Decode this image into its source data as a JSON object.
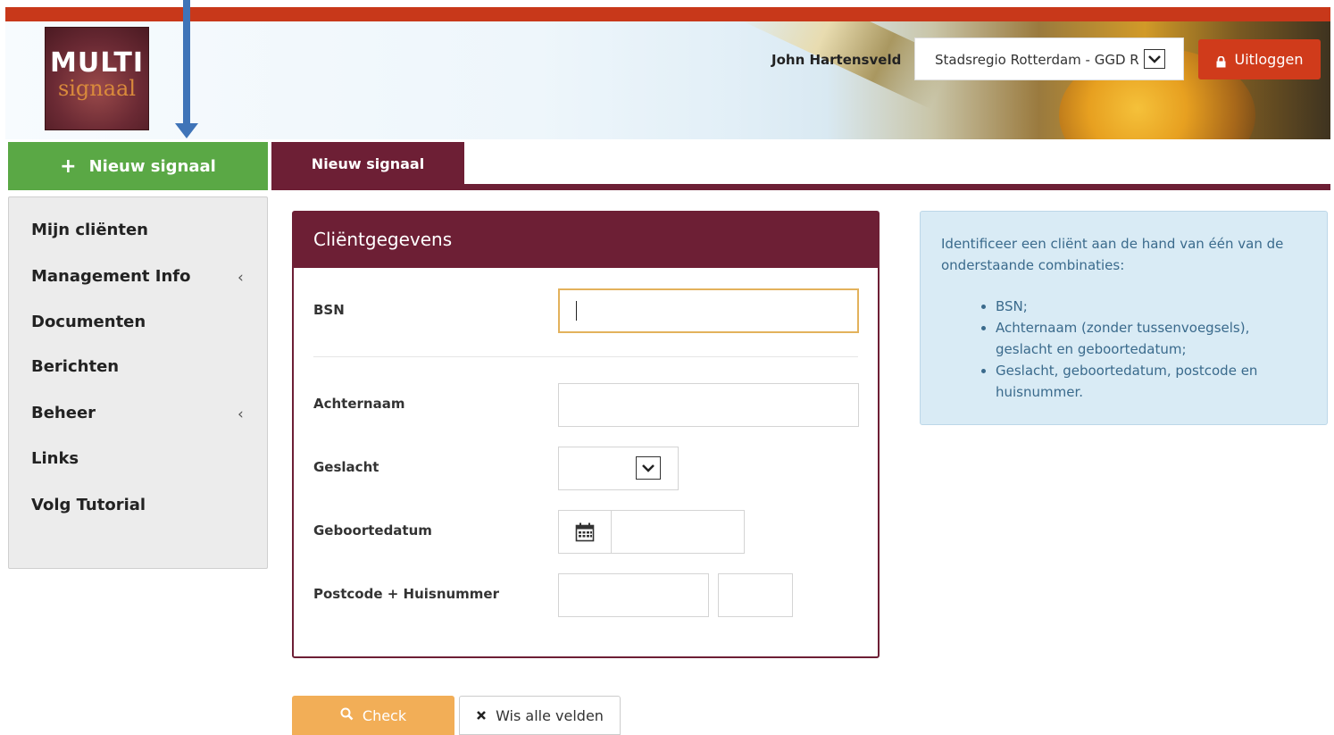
{
  "header": {
    "logo_line1": "MULTI",
    "logo_line2": "signaal",
    "user_name": "John Hartensveld",
    "org_select_value": "Stadsregio Rotterdam - GGD R",
    "logout_label": "Uitloggen",
    "colors": {
      "topbar": "#c8381a",
      "logout": "#d03b1b"
    }
  },
  "new_signal_button": {
    "label": "Nieuw signaal",
    "icon": "plus-icon",
    "color": "#5aa845"
  },
  "tabs": [
    {
      "label": "Nieuw signaal",
      "active": true
    }
  ],
  "sidebar": {
    "items": [
      {
        "label": "Mijn cliënten",
        "has_submenu": false
      },
      {
        "label": "Management Info",
        "has_submenu": true
      },
      {
        "label": "Documenten",
        "has_submenu": false
      },
      {
        "label": "Berichten",
        "has_submenu": false
      },
      {
        "label": "Beheer",
        "has_submenu": true
      },
      {
        "label": "Links",
        "has_submenu": false
      },
      {
        "label": "Volg Tutorial",
        "has_submenu": false
      }
    ]
  },
  "form": {
    "title": "Cliëntgegevens",
    "fields": {
      "bsn": {
        "label": "BSN",
        "value": ""
      },
      "achternaam": {
        "label": "Achternaam",
        "value": ""
      },
      "geslacht": {
        "label": "Geslacht",
        "value": ""
      },
      "geboortedatum": {
        "label": "Geboortedatum",
        "value": ""
      },
      "postcode_huisnummer": {
        "label": "Postcode + Huisnummer",
        "postcode": "",
        "huisnummer": ""
      }
    },
    "accent_color": "#6d1f35"
  },
  "info_box": {
    "intro": "Identificeer een cliënt aan de hand van één van de onderstaande combinaties:",
    "items": [
      "BSN;",
      "Achternaam (zonder tussenvoegsels), geslacht en geboortedatum;",
      "Geslacht, geboortedatum, postcode en huisnummer."
    ]
  },
  "actions": {
    "check_label": "Check",
    "clear_label": "Wis alle velden",
    "check_color": "#f2ae57"
  }
}
